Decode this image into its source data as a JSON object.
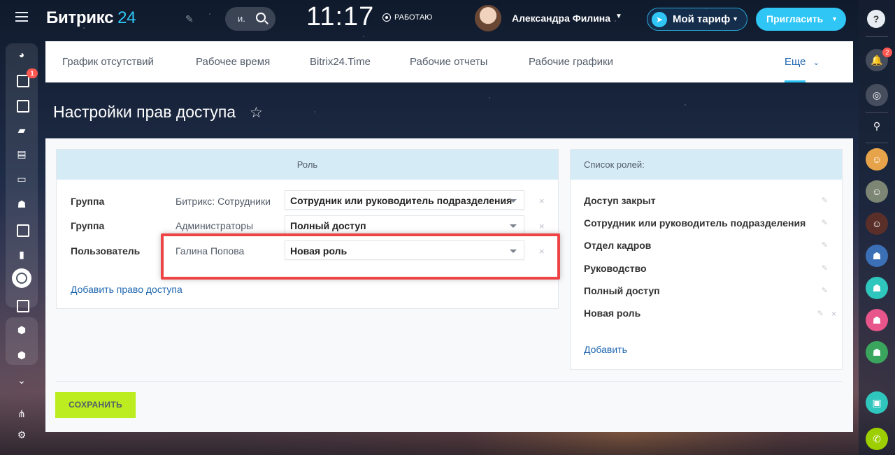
{
  "header": {
    "logo_main": "Битрикс",
    "logo_num": "24",
    "search_placeholder": "и.",
    "clock": "11:17",
    "work_status": "РАБОТАЮ",
    "user_name": "Александра Филина",
    "tariff_label": "Мой тариф",
    "invite_label": "Пригласить"
  },
  "left_sidebar": {
    "tasks_badge": "1",
    "icons": [
      "pie-chart-icon",
      "inbox-icon",
      "calendar-icon",
      "chat-icon",
      "document-icon",
      "drive-icon",
      "group-icon",
      "window-icon",
      "video-icon",
      "clock-icon",
      "contact-card-icon",
      "box-icon",
      "box-icon",
      "chevron-down-icon",
      "sitemap-icon",
      "gear-icon"
    ]
  },
  "right_sidebar": {
    "help": "?",
    "notifications_badge": "2"
  },
  "nav": {
    "items": [
      "График отсутствий",
      "Рабочее время",
      "Bitrix24.Time",
      "Рабочие отчеты",
      "Рабочие графики"
    ],
    "more": "Еще"
  },
  "page": {
    "title": "Настройки прав доступа"
  },
  "roles_table": {
    "header": "Роль",
    "rows": [
      {
        "type": "Группа",
        "name": "Битрикс: Сотрудники",
        "role": "Сотрудник или руководитель подразделения"
      },
      {
        "type": "Группа",
        "name": "Администраторы",
        "role": "Полный доступ"
      },
      {
        "type": "Пользователь",
        "name": "Галина Попова",
        "role": "Новая роль"
      }
    ],
    "add_link": "Добавить право доступа",
    "remove_symbol": "×"
  },
  "roles_list": {
    "header": "Список ролей:",
    "items": [
      "Доступ закрыт",
      "Сотрудник или руководитель подразделения",
      "Отдел кадров",
      "Руководство",
      "Полный доступ",
      "Новая роль"
    ],
    "add_link": "Добавить"
  },
  "actions": {
    "save": "СОХРАНИТЬ"
  },
  "colors": {
    "accent": "#2fc6f6",
    "link": "#2067b0",
    "save_button": "#bbed21",
    "highlight_frame": "#ee4446",
    "table_header": "#d5ecf6"
  }
}
